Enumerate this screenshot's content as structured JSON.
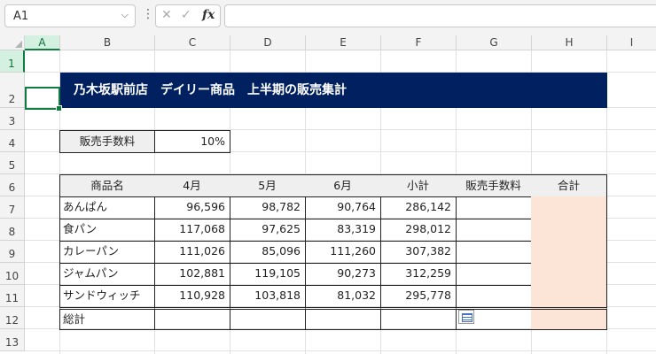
{
  "formula_bar": {
    "name_box": "A1",
    "cancel_icon": "✕",
    "enter_icon": "✓",
    "fx_label": "fx",
    "formula": ""
  },
  "columns": [
    "A",
    "B",
    "C",
    "D",
    "E",
    "F",
    "G",
    "H",
    "I"
  ],
  "rows": [
    "1",
    "2",
    "3",
    "4",
    "5",
    "6",
    "7",
    "8",
    "9",
    "10",
    "11",
    "12",
    "13"
  ],
  "sheet": {
    "title": "乃木坂駅前店　デイリー商品　上半期の販売集計",
    "fee_label": "販売手数料",
    "fee_value": "10%",
    "table": {
      "headers": [
        "商品名",
        "4月",
        "5月",
        "6月",
        "小計",
        "販売手数料",
        "合計"
      ],
      "rows": [
        {
          "name": "あんぱん",
          "apr": "96,596",
          "may": "98,782",
          "jun": "90,764",
          "subtotal": "286,142",
          "fee": "",
          "total": ""
        },
        {
          "name": "食パン",
          "apr": "117,068",
          "may": "97,625",
          "jun": "83,319",
          "subtotal": "298,012",
          "fee": "",
          "total": ""
        },
        {
          "name": "カレーパン",
          "apr": "111,026",
          "may": "85,096",
          "jun": "111,260",
          "subtotal": "307,382",
          "fee": "",
          "total": ""
        },
        {
          "name": "ジャムパン",
          "apr": "102,881",
          "may": "119,105",
          "jun": "90,273",
          "subtotal": "312,259",
          "fee": "",
          "total": ""
        },
        {
          "name": "サンドウィッチ",
          "apr": "110,928",
          "may": "103,818",
          "jun": "81,032",
          "subtotal": "295,778",
          "fee": "",
          "total": ""
        }
      ],
      "total_label": "総計"
    }
  },
  "colors": {
    "title_bg": "#002060",
    "total_column": "#fce4d6",
    "selection": "#107c41"
  }
}
